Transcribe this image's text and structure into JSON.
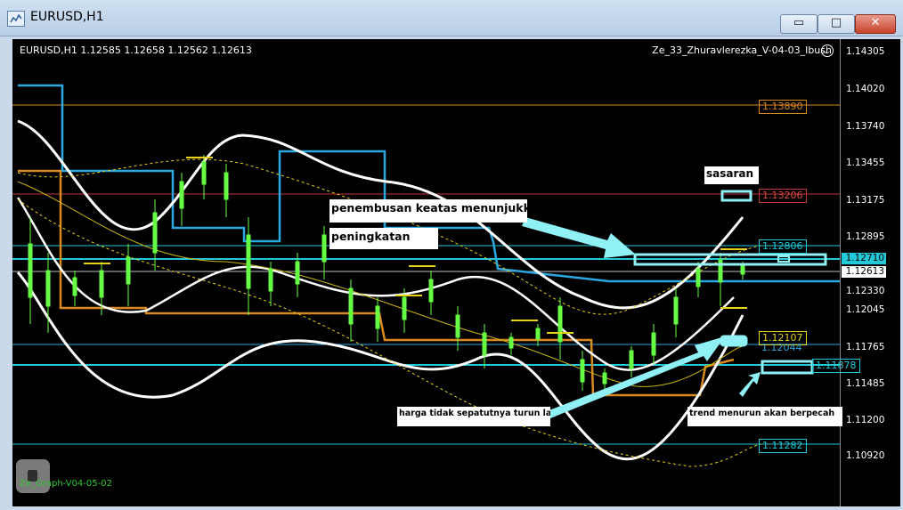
{
  "window": {
    "title": "EURUSD,H1",
    "buttons": {
      "minimize": "▭",
      "maximize": "□",
      "close": "✕"
    }
  },
  "chart": {
    "header": "EURUSD,H1  1.12585 1.12658 1.12562 1.12613",
    "expert": "Ze_33_Zhuravlerezka_V-04-03_Ibush",
    "footer": "Ze_Graph-V04-05-02",
    "price_axis": [
      "1.14305",
      "1.14020",
      "1.13740",
      "1.13455",
      "1.13175",
      "1.12895",
      "1.12615",
      "1.12330",
      "1.12045",
      "1.11765",
      "1.11485",
      "1.11200",
      "1.10920"
    ],
    "current_price": "1.12613",
    "current_price_high": "1.12710",
    "level_labels": {
      "orange_top": "1.13890",
      "red": "1.13206",
      "cyan_upper": "1.12806",
      "yellow": "1.12107",
      "blue": "1.12044",
      "cyan_mid": "1.11878",
      "cyan_low": "1.11282"
    },
    "annotations": {
      "target": "sasaran",
      "breakout": "penembusan keatas menunjukkan pe",
      "rise": "peningkatan",
      "no_drop": "harga tidak sepatutnya turun lagi",
      "downtrend": "trend menurun akan berpecah"
    },
    "colors": {
      "background": "#000000",
      "bull_candle": "#66ff44",
      "orange_level": "#d98a1f",
      "red_level": "#c0392b",
      "cyan_level": "#22c9d9",
      "blue_line": "#2aa8e0",
      "yellow_label": "#e8d21a"
    }
  }
}
